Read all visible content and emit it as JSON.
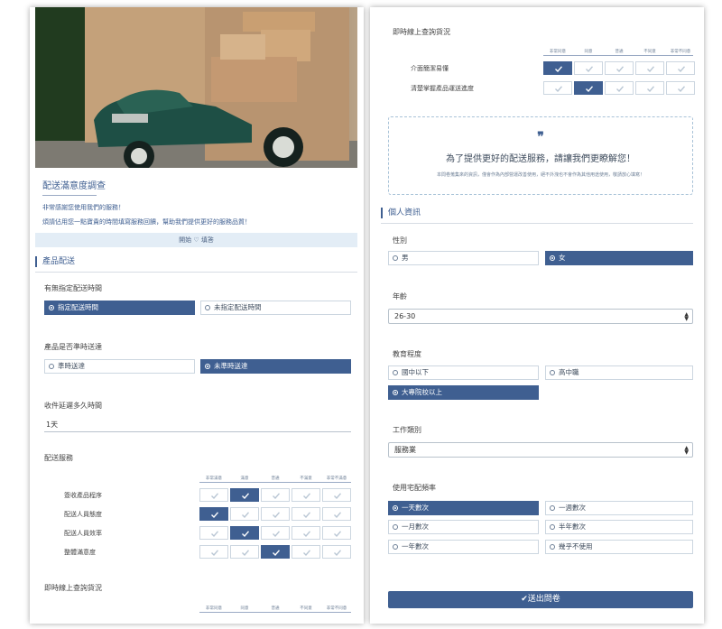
{
  "survey": {
    "title": "配送滿意度調查",
    "intro_1": "非常感謝您使用我們的服務！",
    "intro_2": "煩請佔用您一點寶貴的時間填寫服務回饋，幫助我們提供更好的服務品質！",
    "start_label": "開始 ♡ 填答"
  },
  "scale": [
    "非常同意",
    "同意",
    "普通",
    "不同意",
    "非常不同意"
  ],
  "scale_satisfaction": [
    "非常滿意",
    "滿意",
    "普通",
    "不滿意",
    "非常不滿意"
  ],
  "product_delivery": {
    "section_title": "產品配送",
    "q1": {
      "label": "有無指定配送時間",
      "options": [
        "指定配送時間",
        "未指定配送時間"
      ],
      "selected": 0
    },
    "q2": {
      "label": "產品是否準時送達",
      "options": [
        "準時送達",
        "未準時送達"
      ],
      "selected": 1
    },
    "q3": {
      "label": "收件延遲多久時間",
      "value": "1天"
    },
    "q4": {
      "label": "配送服務",
      "rows": [
        "簽收產品程序",
        "配送人員態度",
        "配送人員效率",
        "整體滿意度"
      ],
      "selected": [
        1,
        0,
        1,
        2
      ]
    },
    "q5": {
      "label": "即時線上查詢貨況"
    }
  },
  "online_query": {
    "label": "即時線上查詢貨況",
    "rows": [
      "介面簡潔易懂",
      "清楚掌握產品運送進度"
    ],
    "selected": [
      0,
      1
    ]
  },
  "quote": {
    "mark": "❞",
    "title": "為了提供更好的配送服務，請讓我們更瞭解您！",
    "subtitle": "本問卷蒐集來的資訊，僅會作為內部營運改善使用，絕不外洩也不會作為其他用途使用，敬請放心填寫！"
  },
  "personal": {
    "section_title": "個人資訊",
    "gender": {
      "label": "性別",
      "options": [
        "男",
        "女"
      ],
      "selected": 1
    },
    "age": {
      "label": "年齡",
      "value": "26-30"
    },
    "education": {
      "label": "教育程度",
      "options": [
        "國中以下",
        "高中職",
        "大專院校以上"
      ],
      "selected": 2
    },
    "job": {
      "label": "工作類別",
      "value": "服務業"
    },
    "frequency": {
      "label": "使用宅配頻率",
      "options": [
        "一天數次",
        "一週數次",
        "一月數次",
        "半年數次",
        "一年數次",
        "幾乎不使用"
      ],
      "selected": 0
    }
  },
  "submit_label": "✔送出問卷",
  "colors": {
    "accent": "#3f5f91",
    "start_bar": "#e3edf6",
    "border": "#ccd6e0"
  }
}
